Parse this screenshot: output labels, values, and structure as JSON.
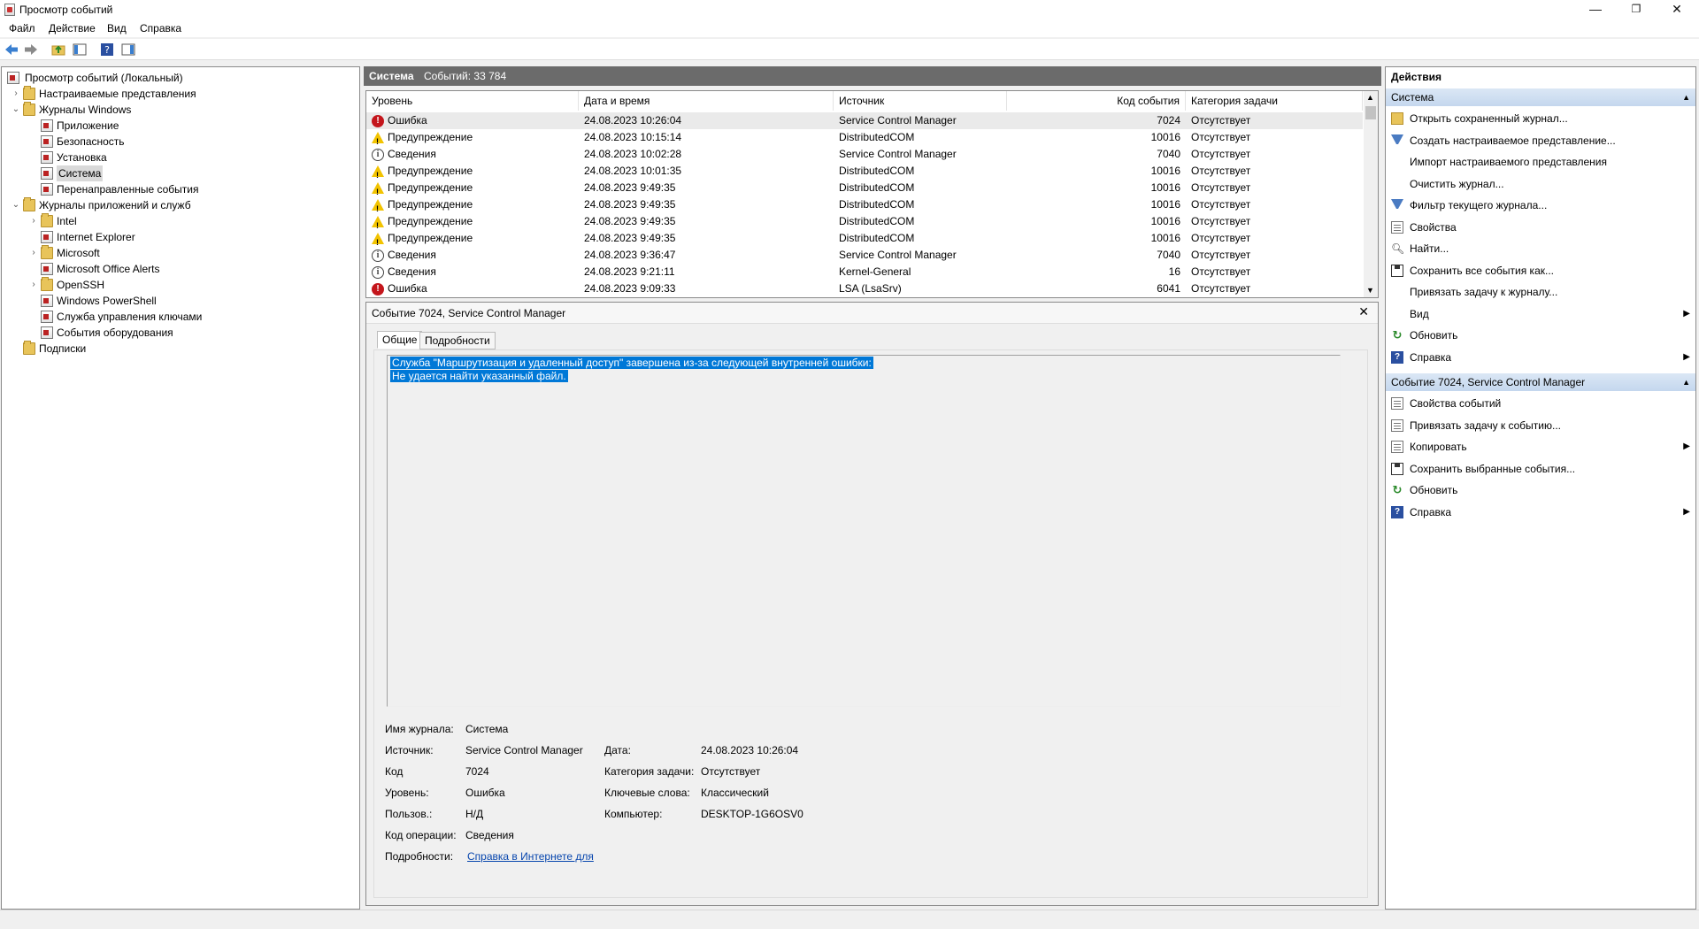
{
  "window": {
    "title": "Просмотр событий",
    "controls": {
      "minimize": "—",
      "restore": "❐",
      "close": "✕"
    }
  },
  "menu": [
    "Файл",
    "Действие",
    "Вид",
    "Справка"
  ],
  "tree": {
    "root": "Просмотр событий (Локальный)",
    "items": [
      {
        "label": "Настраиваемые представления",
        "level": 1,
        "chevron": "›",
        "icon": "folder-icon"
      },
      {
        "label": "Журналы Windows",
        "level": 1,
        "chevron": "⌄",
        "icon": "folder-icon"
      },
      {
        "label": "Приложение",
        "level": 2,
        "chevron": "",
        "icon": "log-icon"
      },
      {
        "label": "Безопасность",
        "level": 2,
        "chevron": "",
        "icon": "log-icon"
      },
      {
        "label": "Установка",
        "level": 2,
        "chevron": "",
        "icon": "log-icon"
      },
      {
        "label": "Система",
        "level": 2,
        "chevron": "",
        "icon": "log-icon",
        "selected": true
      },
      {
        "label": "Перенаправленные события",
        "level": 2,
        "chevron": "",
        "icon": "log-icon"
      },
      {
        "label": "Журналы приложений и служб",
        "level": 1,
        "chevron": "⌄",
        "icon": "folder-icon"
      },
      {
        "label": "Intel",
        "level": 2,
        "chevron": "›",
        "icon": "folder-icon"
      },
      {
        "label": "Internet Explorer",
        "level": 2,
        "chevron": "",
        "icon": "log-icon"
      },
      {
        "label": "Microsoft",
        "level": 2,
        "chevron": "›",
        "icon": "folder-icon"
      },
      {
        "label": "Microsoft Office Alerts",
        "level": 2,
        "chevron": "",
        "icon": "log-icon"
      },
      {
        "label": "OpenSSH",
        "level": 2,
        "chevron": "›",
        "icon": "folder-icon"
      },
      {
        "label": "Windows PowerShell",
        "level": 2,
        "chevron": "",
        "icon": "log-icon"
      },
      {
        "label": "Служба управления ключами",
        "level": 2,
        "chevron": "",
        "icon": "log-icon"
      },
      {
        "label": "События оборудования",
        "level": 2,
        "chevron": "",
        "icon": "log-icon"
      },
      {
        "label": "Подписки",
        "level": 1,
        "chevron": "",
        "icon": "folder-icon"
      }
    ]
  },
  "log_header": {
    "name": "Система",
    "count": "Событий: 33 784"
  },
  "columns": [
    "Уровень",
    "Дата и время",
    "Источник",
    "Код события",
    "Категория задачи"
  ],
  "events": [
    {
      "level": "Ошибка",
      "type": "error",
      "date": "24.08.2023 10:26:04",
      "source": "Service Control Manager",
      "code": "7024",
      "category": "Отсутствует",
      "selected": true
    },
    {
      "level": "Предупреждение",
      "type": "warning",
      "date": "24.08.2023 10:15:14",
      "source": "DistributedCOM",
      "code": "10016",
      "category": "Отсутствует"
    },
    {
      "level": "Сведения",
      "type": "info",
      "date": "24.08.2023 10:02:28",
      "source": "Service Control Manager",
      "code": "7040",
      "category": "Отсутствует"
    },
    {
      "level": "Предупреждение",
      "type": "warning",
      "date": "24.08.2023 10:01:35",
      "source": "DistributedCOM",
      "code": "10016",
      "category": "Отсутствует"
    },
    {
      "level": "Предупреждение",
      "type": "warning",
      "date": "24.08.2023 9:49:35",
      "source": "DistributedCOM",
      "code": "10016",
      "category": "Отсутствует"
    },
    {
      "level": "Предупреждение",
      "type": "warning",
      "date": "24.08.2023 9:49:35",
      "source": "DistributedCOM",
      "code": "10016",
      "category": "Отсутствует"
    },
    {
      "level": "Предупреждение",
      "type": "warning",
      "date": "24.08.2023 9:49:35",
      "source": "DistributedCOM",
      "code": "10016",
      "category": "Отсутствует"
    },
    {
      "level": "Предупреждение",
      "type": "warning",
      "date": "24.08.2023 9:49:35",
      "source": "DistributedCOM",
      "code": "10016",
      "category": "Отсутствует"
    },
    {
      "level": "Сведения",
      "type": "info",
      "date": "24.08.2023 9:36:47",
      "source": "Service Control Manager",
      "code": "7040",
      "category": "Отсутствует"
    },
    {
      "level": "Сведения",
      "type": "info",
      "date": "24.08.2023 9:21:11",
      "source": "Kernel-General",
      "code": "16",
      "category": "Отсутствует"
    },
    {
      "level": "Ошибка",
      "type": "error",
      "date": "24.08.2023 9:09:33",
      "source": "LSA (LsaSrv)",
      "code": "6041",
      "category": "Отсутствует"
    }
  ],
  "details": {
    "title": "Событие 7024, Service Control Manager",
    "tabs": [
      "Общие",
      "Подробности"
    ],
    "message": [
      "Служба \"Маршрутизация и удаленный доступ\" завершена из-за следующей внутренней ошибки:",
      "Не удается найти указанный файл."
    ],
    "fields": {
      "log_name_label": "Имя журнала:",
      "log_name": "Система",
      "source_label": "Источник:",
      "source": "Service Control Manager",
      "date_label": "Дата:",
      "date": "24.08.2023 10:26:04",
      "code_label": "Код",
      "code": "7024",
      "task_label": "Категория задачи:",
      "task": "Отсутствует",
      "level_label": "Уровень:",
      "level": "Ошибка",
      "keywords_label": "Ключевые слова:",
      "keywords": "Классический",
      "user_label": "Пользов.:",
      "user": "Н/Д",
      "computer_label": "Компьютер:",
      "computer": "DESKTOP-1G6OSV0",
      "opcode_label": "Код операции:",
      "opcode": "Сведения",
      "more_label": "Подробности:",
      "more_link": "Справка в Интернете для"
    }
  },
  "actions": {
    "title": "Действия",
    "section1": "Система",
    "items1": [
      {
        "label": "Открыть сохраненный журнал...",
        "icon": "open-log-icon"
      },
      {
        "label": "Создать настраиваемое представление...",
        "icon": "create-view-icon"
      },
      {
        "label": "Импорт настраиваемого представления",
        "icon": ""
      },
      {
        "label": "Очистить журнал...",
        "icon": ""
      },
      {
        "label": "Фильтр текущего журнала...",
        "icon": "filter-icon"
      },
      {
        "label": "Свойства",
        "icon": "properties-icon"
      },
      {
        "label": "Найти...",
        "icon": "find-icon"
      },
      {
        "label": "Сохранить все события как...",
        "icon": "save-icon"
      },
      {
        "label": "Привязать задачу к журналу...",
        "icon": ""
      },
      {
        "label": "Вид",
        "icon": "",
        "submenu": true
      },
      {
        "label": "Обновить",
        "icon": "refresh-icon"
      },
      {
        "label": "Справка",
        "icon": "help-icon",
        "submenu": true
      }
    ],
    "section2": "Событие 7024, Service Control Manager",
    "items2": [
      {
        "label": "Свойства событий",
        "icon": "properties-icon"
      },
      {
        "label": "Привязать задачу к событию...",
        "icon": "task-icon"
      },
      {
        "label": "Копировать",
        "icon": "copy-icon",
        "submenu": true
      },
      {
        "label": "Сохранить выбранные события...",
        "icon": "save-icon"
      },
      {
        "label": "Обновить",
        "icon": "refresh-icon"
      },
      {
        "label": "Справка",
        "icon": "help-icon",
        "submenu": true
      }
    ]
  },
  "colors": {
    "accent": "#0078d7",
    "error": "#c4161c",
    "warning": "#f2c300",
    "header": "#6b6b6b"
  }
}
